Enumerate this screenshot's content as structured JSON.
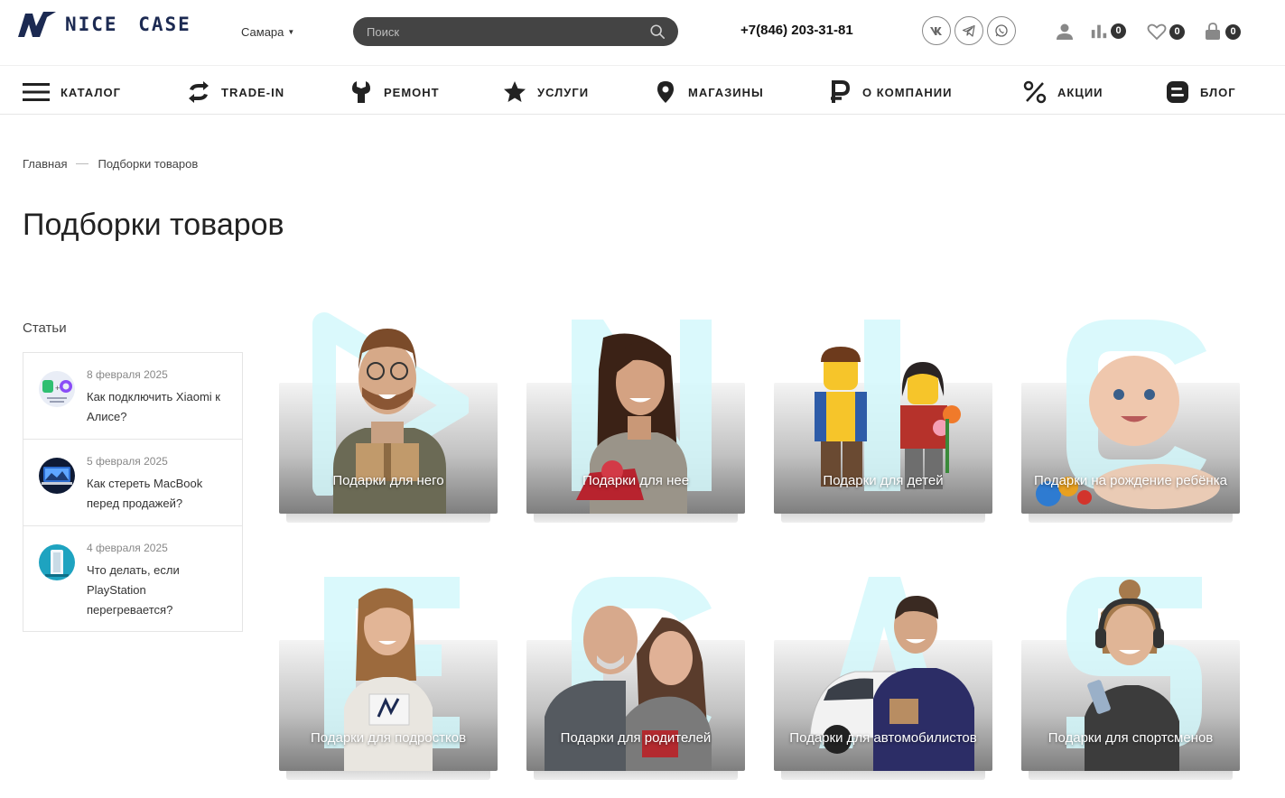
{
  "header": {
    "logo_text": "NICE CASE",
    "city": "Самара",
    "search_placeholder": "Поиск",
    "phone": "+7(846) 203-31-81",
    "compare_count": "0",
    "favorites_count": "0",
    "cart_count": "0"
  },
  "nav": {
    "items": [
      {
        "label": "КАТАЛОГ",
        "icon": "menu-icon"
      },
      {
        "label": "TRADE-IN",
        "icon": "exchange-icon"
      },
      {
        "label": "РЕМОНТ",
        "icon": "wrench-icon"
      },
      {
        "label": "УСЛУГИ",
        "icon": "star-icon"
      },
      {
        "label": "МАГАЗИНЫ",
        "icon": "map-pin-icon"
      },
      {
        "label": "О КОМПАНИИ",
        "icon": "ruble-icon"
      },
      {
        "label": "АКЦИИ",
        "icon": "percent-icon"
      },
      {
        "label": "БЛОГ",
        "icon": "blog-icon"
      }
    ]
  },
  "breadcrumb": {
    "home": "Главная",
    "current": "Подборки товаров"
  },
  "page": {
    "title": "Подборки товаров"
  },
  "sidebar": {
    "title": "Статьи",
    "articles": [
      {
        "date": "8 февраля 2025",
        "title": "Как подключить Xiaomi к Алисе?"
      },
      {
        "date": "5 февраля 2025",
        "title": "Как стереть MacBook перед продажей?"
      },
      {
        "date": "4 февраля 2025",
        "title": "Что делать, если PlayStation перегревается?"
      }
    ]
  },
  "collections": [
    {
      "label": "Подарки для него"
    },
    {
      "label": "Подарки для нее"
    },
    {
      "label": "Подарки для детей"
    },
    {
      "label": "Подарки на рождение ребёнка"
    },
    {
      "label": "Подарки для подростков"
    },
    {
      "label": "Подарки для родителей"
    },
    {
      "label": "Подарки для автомобилистов"
    },
    {
      "label": "Подарки для спортсменов"
    }
  ],
  "colors": {
    "brand": "#1c2a52",
    "search_bg": "#444444",
    "watermark": "#d4f8fb"
  }
}
